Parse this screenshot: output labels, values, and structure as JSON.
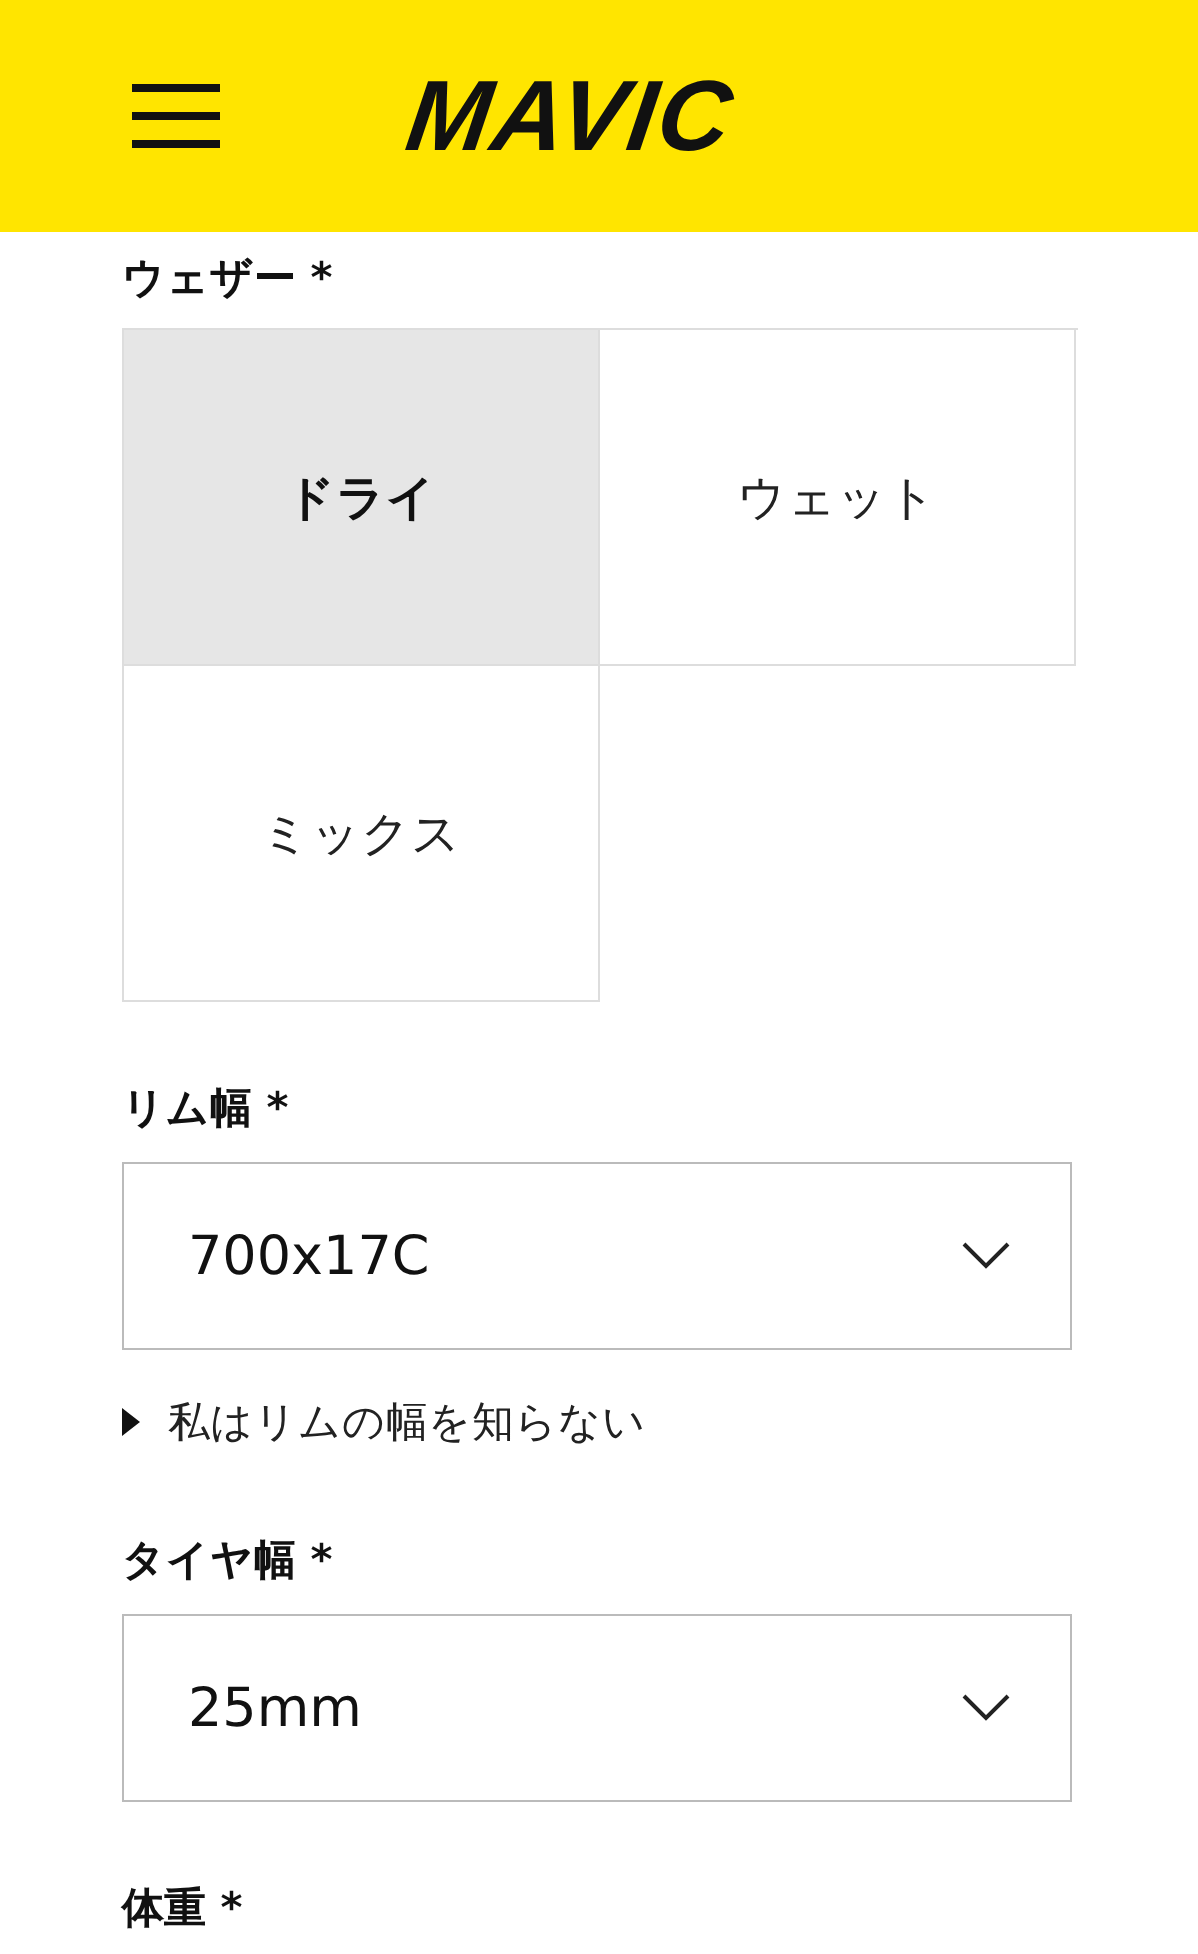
{
  "header": {
    "logo": "MAVIC"
  },
  "weather": {
    "label": "ウェザー *",
    "options": [
      {
        "label": "ドライ",
        "selected": true
      },
      {
        "label": "ウェット",
        "selected": false
      },
      {
        "label": "ミックス",
        "selected": false
      }
    ]
  },
  "rim_width": {
    "label": "リム幅 *",
    "value": "700x17C",
    "help": "私はリムの幅を知らない"
  },
  "tire_width": {
    "label": "タイヤ幅 *",
    "value": "25mm"
  },
  "weight": {
    "label": "体重 *"
  }
}
